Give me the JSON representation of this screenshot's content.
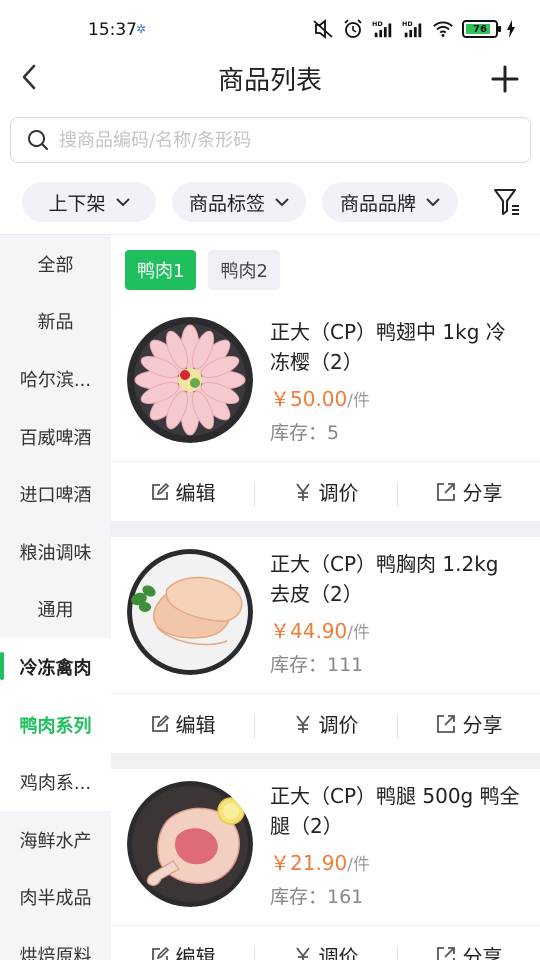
{
  "status": {
    "time": "15:37",
    "battery": "76"
  },
  "header": {
    "title": "商品列表"
  },
  "search": {
    "placeholder": "搜商品编码/名称/条形码"
  },
  "filters": [
    {
      "label": "上下架"
    },
    {
      "label": "商品标签"
    },
    {
      "label": "商品品牌"
    }
  ],
  "categories": [
    {
      "label": "全部"
    },
    {
      "label": "新品"
    },
    {
      "label": "哈尔滨..."
    },
    {
      "label": "百威啤酒"
    },
    {
      "label": "进口啤酒"
    },
    {
      "label": "粮油调味"
    },
    {
      "label": "通用"
    },
    {
      "label": "冷冻禽肉"
    },
    {
      "label": "鸭肉系列"
    },
    {
      "label": "鸡肉系..."
    },
    {
      "label": "海鲜水产"
    },
    {
      "label": "肉半成品"
    },
    {
      "label": "烘焙原料"
    }
  ],
  "subtabs": [
    {
      "label": "鸭肉1"
    },
    {
      "label": "鸭肉2"
    }
  ],
  "products": [
    {
      "name": "正大（CP）鸭翅中 1kg 冷冻樱（2）",
      "price": "￥50.00",
      "unit": "/件",
      "stock": "库存：5"
    },
    {
      "name": "正大（CP）鸭胸肉 1.2kg 去皮（2）",
      "price": "￥44.90",
      "unit": "/件",
      "stock": "库存：111"
    },
    {
      "name": "正大（CP）鸭腿 500g 鸭全腿（2）",
      "price": "￥21.90",
      "unit": "/件",
      "stock": "库存：161"
    }
  ],
  "actions": {
    "edit": "编辑",
    "price": "调价",
    "share": "分享"
  },
  "colors": {
    "accent": "#1fbf5e",
    "price": "#f07c3a"
  },
  "icons": [
    "back-icon",
    "plus-icon",
    "search-icon",
    "chevron-down-icon",
    "filter-icon",
    "edit-icon",
    "yen-icon",
    "share-icon"
  ]
}
